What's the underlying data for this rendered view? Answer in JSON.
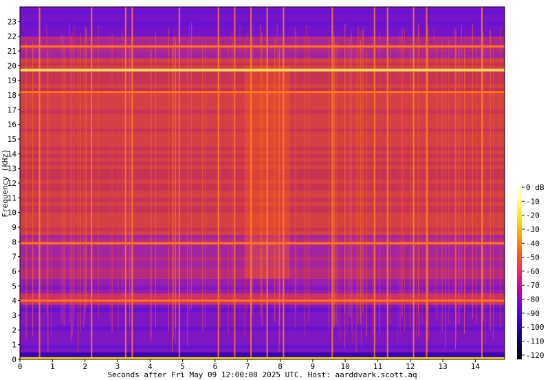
{
  "chart_data": {
    "type": "heatmap",
    "title": "",
    "xlabel": "Seconds after Fri May 09 12:00:00 2025 UTC. Host: aarddvark.scott.aq",
    "ylabel": "Frequency (kHz)",
    "xlim": [
      0,
      14.9
    ],
    "ylim": [
      0,
      24
    ],
    "x_ticks": [
      0,
      1,
      2,
      3,
      4,
      5,
      6,
      7,
      8,
      9,
      10,
      11,
      12,
      13,
      14
    ],
    "y_ticks": [
      0,
      1,
      2,
      3,
      4,
      5,
      6,
      7,
      8,
      9,
      10,
      11,
      12,
      13,
      14,
      15,
      16,
      17,
      18,
      19,
      20,
      21,
      22,
      23
    ],
    "colorbar": {
      "label_ticks": [
        "0 dB",
        "-10",
        "-20",
        "-30",
        "-40",
        "-50",
        "-60",
        "-70",
        "-80",
        "-90",
        "-100",
        "-110",
        "-120"
      ],
      "range_db": [
        -125,
        0
      ],
      "colormap": [
        "#000000",
        "#0a0060",
        "#2a00c8",
        "#7000e8",
        "#c000a0",
        "#ff2060",
        "#ff5a10",
        "#ff9c00",
        "#ffe000",
        "#ffff80",
        "#ffffff"
      ]
    },
    "features": {
      "tone_lines_khz": [
        19.7,
        21.3,
        18.2,
        7.9,
        4.0
      ],
      "sferic_times_s": [
        0.6,
        2.2,
        3.25,
        3.45,
        4.9,
        6.1,
        6.6,
        7.1,
        7.6,
        8.1,
        9.6,
        10.9,
        11.3,
        12.1,
        12.5,
        14.2
      ],
      "strong_band_khz": [
        5.5,
        20.5
      ],
      "strong_time_segment_s": [
        6.9,
        8.3
      ]
    }
  }
}
